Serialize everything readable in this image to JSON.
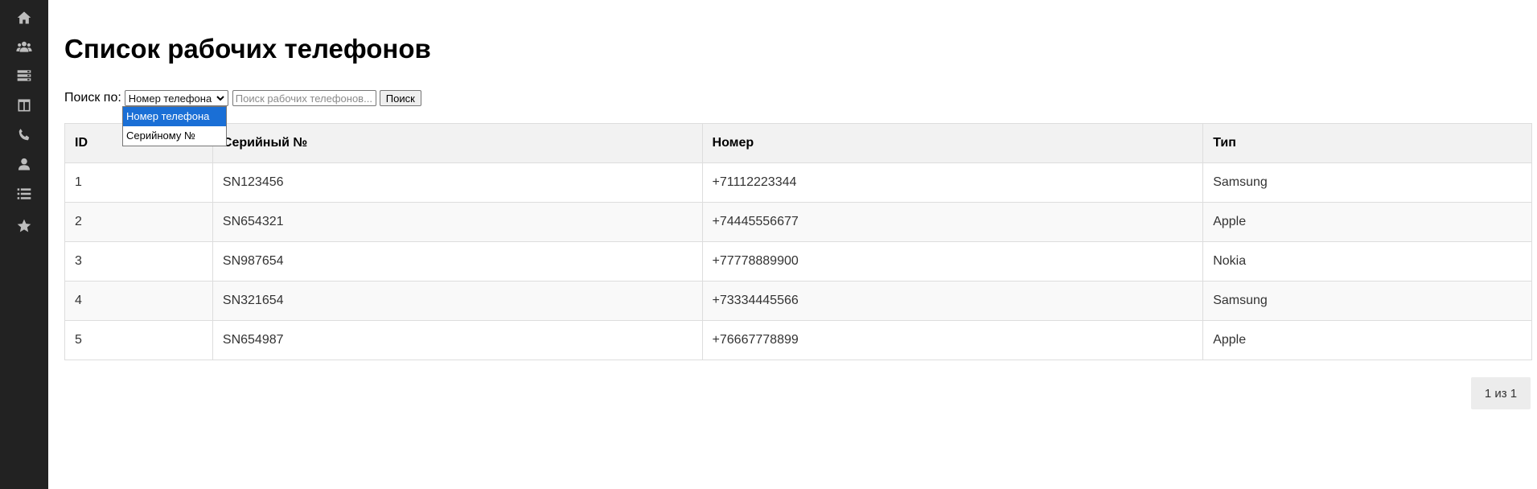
{
  "sidebar": {
    "items": [
      {
        "icon": "home-icon"
      },
      {
        "icon": "users-icon"
      },
      {
        "icon": "server-icon"
      },
      {
        "icon": "columns-icon"
      },
      {
        "icon": "phone-icon"
      },
      {
        "icon": "user-icon"
      },
      {
        "icon": "list-icon"
      },
      {
        "icon": "star-icon"
      }
    ]
  },
  "page": {
    "title": "Список рабочих телефонов"
  },
  "search": {
    "label": "Поиск по:",
    "selected_option": "Номер телефона",
    "options": [
      "Номер телефона",
      "Серийному №"
    ],
    "placeholder": "Поиск рабочих телефонов...",
    "button_label": "Поиск"
  },
  "table": {
    "columns": [
      "ID",
      "Серийный №",
      "Номер",
      "Тип"
    ],
    "rows": [
      [
        "1",
        "SN123456",
        "+71112223344",
        "Samsung"
      ],
      [
        "2",
        "SN654321",
        "+74445556677",
        "Apple"
      ],
      [
        "3",
        "SN987654",
        "+77778889900",
        "Nokia"
      ],
      [
        "4",
        "SN321654",
        "+73334445566",
        "Samsung"
      ],
      [
        "5",
        "SN654987",
        "+76667778899",
        "Apple"
      ]
    ]
  },
  "pagination": {
    "text": "1 из 1"
  },
  "colors": {
    "sidebar_bg": "#222222",
    "sidebar_icon": "#bdbdbd",
    "dropdown_highlight": "#1a6fd6",
    "table_header_bg": "#f2f2f2"
  }
}
